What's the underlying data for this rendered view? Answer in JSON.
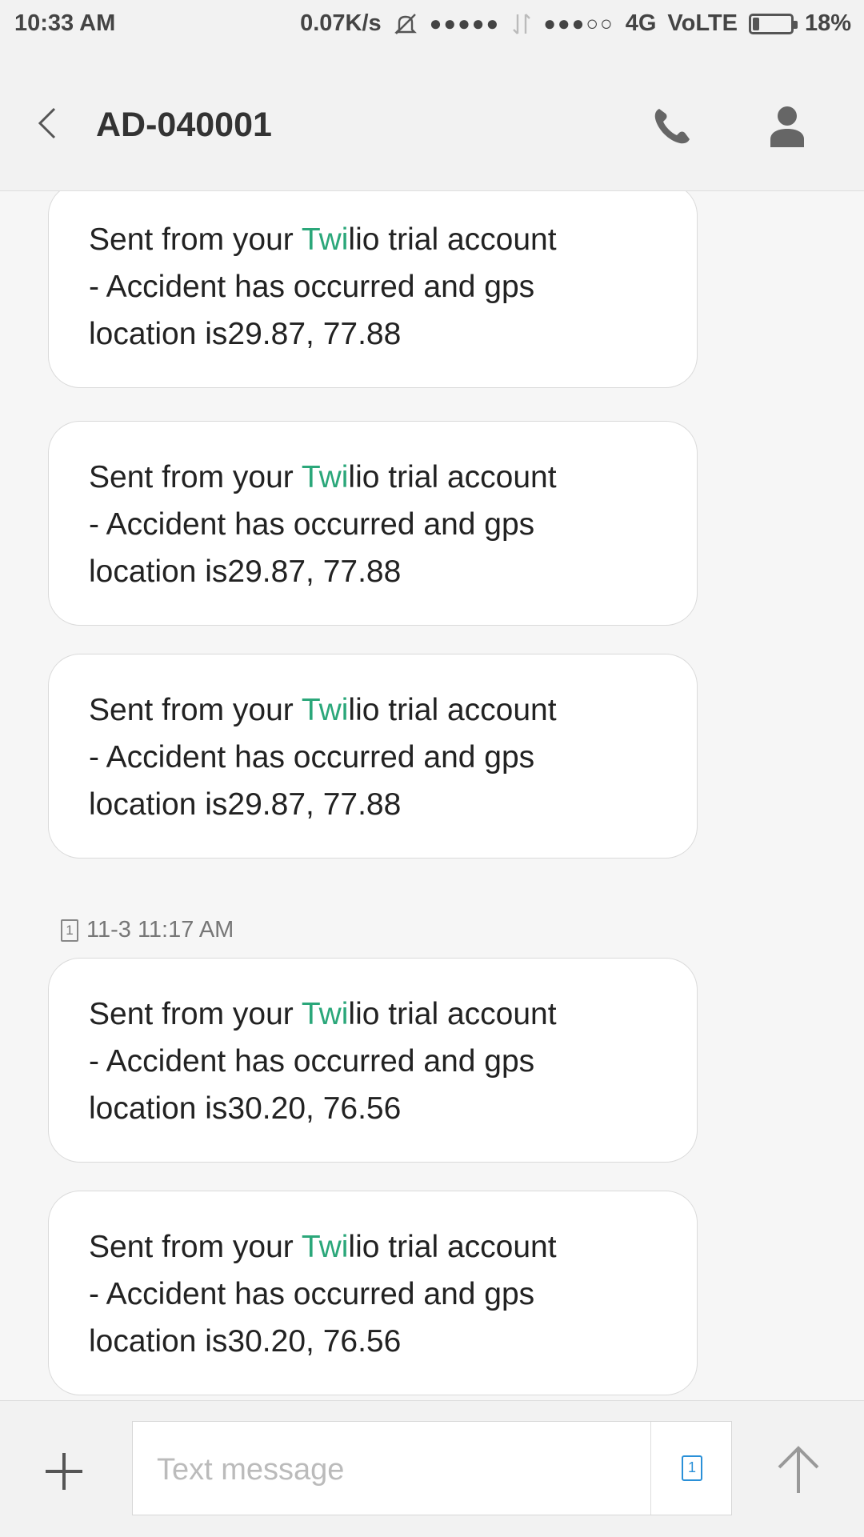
{
  "status_bar": {
    "time": "10:33 AM",
    "net_speed": "0.07K/s",
    "signal1": "●●●●●",
    "signal2": "●●●○○",
    "network": "4G",
    "volte": "VoLTE",
    "battery_level": 0.18,
    "battery_text": "18%"
  },
  "header": {
    "title": "AD-040001",
    "icons": [
      "back-icon",
      "phone-icon",
      "contact-icon"
    ]
  },
  "messages": [
    {
      "prefix": "Sent from your ",
      "brand": "Twi",
      "suffix": "lio trial account",
      "line2": "- Accident has occurred and gps",
      "line3": "location is29.87, 77.88"
    },
    {
      "prefix": "Sent from your ",
      "brand": "Twi",
      "suffix": "lio trial account",
      "line2": "- Accident has occurred and gps",
      "line3": "location is29.87, 77.88"
    },
    {
      "prefix": "Sent from your ",
      "brand": "Twi",
      "suffix": "lio trial account",
      "line2": "- Accident has occurred and gps",
      "line3": "location is29.87, 77.88"
    },
    {
      "prefix": "Sent from your ",
      "brand": "Twi",
      "suffix": "lio trial account",
      "line2": "- Accident has occurred and gps",
      "line3": "location is30.20, 76.56"
    },
    {
      "prefix": "Sent from your ",
      "brand": "Twi",
      "suffix": "lio trial account",
      "line2": "- Accident has occurred and gps",
      "line3": "location is30.20, 76.56"
    }
  ],
  "timestamp": {
    "sim": "1",
    "text": "11-3 11:17 AM"
  },
  "composer": {
    "placeholder": "Text message",
    "value": "",
    "sim": "1"
  },
  "colors": {
    "accent_green": "#2ba77a",
    "accent_blue": "#2a90d8"
  }
}
